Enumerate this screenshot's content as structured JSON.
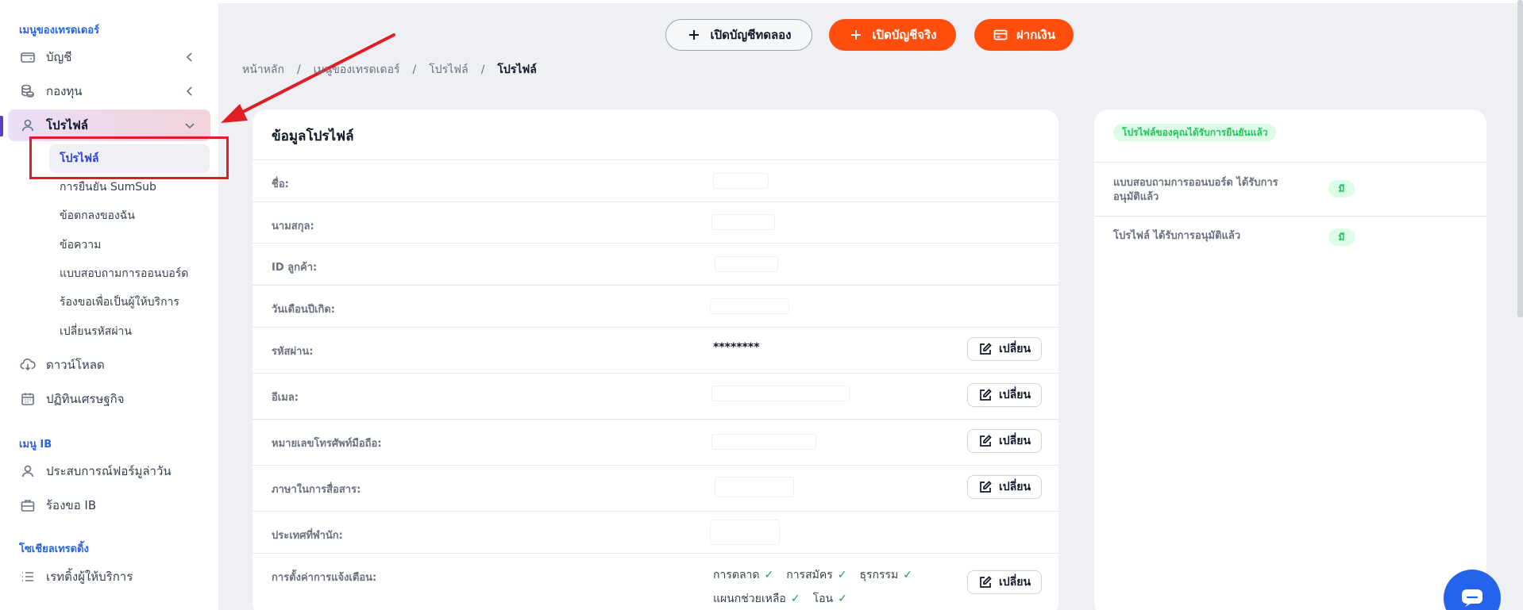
{
  "sidebar": {
    "section_trader": "เมนูของเทรดเดอร์",
    "items": [
      {
        "label": "บัญชี"
      },
      {
        "label": "กองทุน"
      },
      {
        "label": "โปรไฟล์"
      }
    ],
    "profile_sub": [
      {
        "label": "โปรไฟล์"
      },
      {
        "label": "การยืนยัน SumSub"
      },
      {
        "label": "ข้อตกลงของฉัน"
      },
      {
        "label": "ข้อความ"
      },
      {
        "label": "แบบสอบถามการออนบอร์ด"
      },
      {
        "label": "ร้องขอเพื่อเป็นผู้ให้บริการ"
      },
      {
        "label": "เปลี่ยนรหัสผ่าน"
      }
    ],
    "items2": [
      {
        "label": "ดาวน์โหลด"
      },
      {
        "label": "ปฏิทินเศรษฐกิจ"
      }
    ],
    "section_ib": "เมนู IB",
    "ib_items": [
      {
        "label": "ประสบการณ์ฟอร์มูล่าวัน"
      },
      {
        "label": "ร้องขอ IB"
      }
    ],
    "section_social": "โซเชียลเทรดดิ้ง",
    "social_items": [
      {
        "label": "เรทติ้งผู้ให้บริการ"
      }
    ]
  },
  "header": {
    "demo_button": "เปิดบัญชีทดลอง",
    "real_button": "เปิดบัญชีจริง",
    "deposit_button": "ฝากเงิน"
  },
  "breadcrumb": {
    "home": "หน้าหลัก",
    "menu": "เมนูของเทรดเดอร์",
    "profile": "โปรไฟล์",
    "current": "โปรไฟล์"
  },
  "profile": {
    "title": "ข้อมูลโปรไฟล์",
    "edit_label": "เปลี่ยน",
    "rows": [
      {
        "label": "ชื่อ:"
      },
      {
        "label": "นามสกุล:"
      },
      {
        "label": "ID ลูกค้า:"
      },
      {
        "label": "วันเดือนปีเกิด:"
      },
      {
        "label": "รหัสผ่าน:",
        "value": "********"
      },
      {
        "label": "อีเมล:"
      },
      {
        "label": "หมายเลขโทรศัพท์มือถือ:"
      },
      {
        "label": "ภาษาในการสื่อสาร:"
      },
      {
        "label": "ประเทศที่พำนัก:"
      },
      {
        "label": "การตั้งค่าการแจ้งเตือน:"
      }
    ],
    "notifications": [
      "การตลาด",
      "การสมัคร",
      "ธุรกรรม",
      "แผนกช่วยเหลือ",
      "โอน"
    ]
  },
  "verification": {
    "badge": "โปรไฟล์ของคุณได้รับการยืนยันแล้ว",
    "rows": [
      {
        "label": "แบบสอบถามการออนบอร์ด ได้รับการอนุมัติแล้ว",
        "status": "มี"
      },
      {
        "label": "โปรไฟล์ ได้รับการอนุมัติแล้ว",
        "status": "มี"
      }
    ]
  },
  "colors": {
    "accent_orange": "#ff4e0d",
    "accent_blue": "#2563eb",
    "verified_green": "#22c55e",
    "highlight_red": "#e11d26"
  }
}
